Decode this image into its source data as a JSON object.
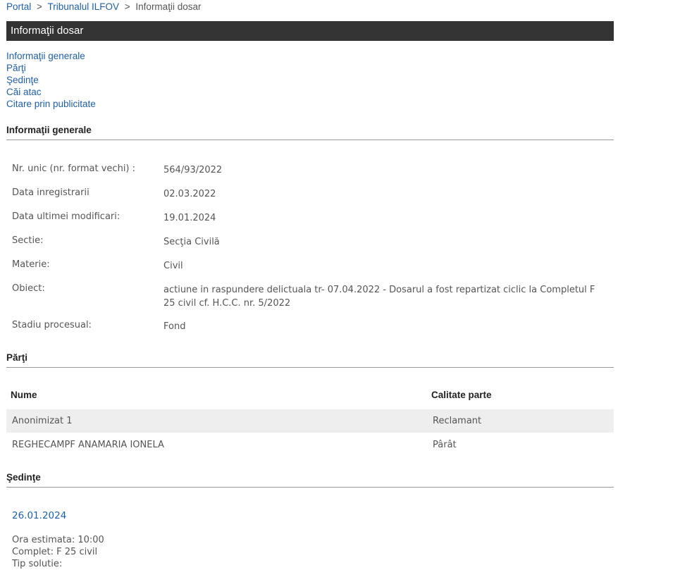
{
  "breadcrumb": {
    "items": [
      "Portal",
      "Tribunalul ILFOV"
    ],
    "current": "Informaţii dosar",
    "separator": ">"
  },
  "page_title": "Informaţii dosar",
  "toc": [
    "Informaţii generale",
    "Părţi",
    "Şedinţe",
    "Căi atac",
    "Citare prin publicitate"
  ],
  "sections": {
    "info": "Informaţii generale",
    "parti": "Părţi",
    "sedinte": "Şedinţe"
  },
  "info": [
    {
      "label": "Nr. unic (nr. format vechi) :",
      "value": "564/93/2022"
    },
    {
      "label": "Data inregistrarii",
      "value": "02.03.2022"
    },
    {
      "label": "Data ultimei modificari:",
      "value": "19.01.2024"
    },
    {
      "label": "Sectie:",
      "value": "Secţia Civilă"
    },
    {
      "label": "Materie:",
      "value": "Civil"
    },
    {
      "label": "Obiect:",
      "value": "actiune in raspundere delictuala tr- 07.04.2022 - Dosarul a fost repartizat ciclic la Completul F 25 civil cf. H.C.C. nr. 5/2022"
    },
    {
      "label": "Stadiu procesual:",
      "value": "Fond"
    }
  ],
  "parti": {
    "headers": [
      "Nume",
      "Calitate parte"
    ],
    "rows": [
      [
        "Anonimizat 1",
        "Reclamant"
      ],
      [
        "REGHECAMPF ANAMARIA IONELA",
        "Pârât"
      ]
    ]
  },
  "sedinta": {
    "date": "26.01.2024",
    "details": [
      "Ora estimata: 10:00",
      "Complet: F 25 civil",
      "Tip solutie:"
    ]
  }
}
